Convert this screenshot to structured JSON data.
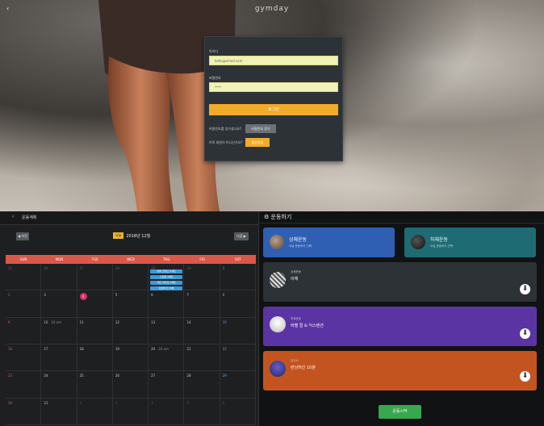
{
  "login_screen": {
    "logo_text": "gymday",
    "back_glyph": "‹",
    "id_label": "아이디",
    "id_value": "hello@email.com",
    "pw_label": "비밀번호",
    "pw_value": "****",
    "login_button": "로그인",
    "find_question": "비밀번호를 잊으셨나요?",
    "find_button": "비밀번호 찾기",
    "signup_question": "아직 회원이 아니신가요?",
    "signup_button": "회원가입"
  },
  "calendar": {
    "title": "운동계획",
    "prev_button": "◀ 이전",
    "next_button": "다음 ▶",
    "today_badge": "오늘",
    "month_label": "2018년 12월",
    "weekdays": [
      "SUN",
      "MON",
      "TUE",
      "WED",
      "THU",
      "FRI",
      "SAT"
    ],
    "weeks": [
      [
        "25",
        "26",
        "27",
        "28",
        "29",
        "30",
        "1"
      ],
      [
        "2",
        "3",
        "4",
        "5",
        "6",
        "7",
        "8"
      ],
      [
        "9",
        "10",
        "11",
        "12",
        "13",
        "14",
        "15"
      ],
      [
        "16",
        "17",
        "18",
        "19",
        "20",
        "21",
        "22"
      ],
      [
        "23",
        "24",
        "25",
        "26",
        "27",
        "28",
        "29"
      ],
      [
        "30",
        "31",
        "1",
        "2",
        "3",
        "4",
        "5"
      ]
    ],
    "today_number": "4",
    "week_labels": {
      "10": "10 am",
      "20": "20 am",
      "30": "30 am"
    },
    "events": [
      "벤치 프레스 5세트",
      "스쿼트 3세트",
      "데드 리프트 4세트",
      "런닝머신 30분"
    ]
  },
  "exercise_panel": {
    "title": "운동하기",
    "upper_card": {
      "name": "상체운동",
      "sub": "오늘 운동하기 선택"
    },
    "lower_card": {
      "name": "하체운동",
      "sub": "오늘 운동하기 선택"
    },
    "list": [
      {
        "category": "상체운동",
        "name": "이체"
      },
      {
        "category": "하체운동",
        "name": "바벨 컬 & 익스텐션"
      },
      {
        "category": "유산소",
        "name": "런닝머신 10분"
      }
    ],
    "start_button": "운동시작"
  },
  "colors": {
    "accent_orange": "#f0ab2a",
    "calendar_header": "#d9584a",
    "today_pink": "#d6326b",
    "event_blue": "#3d9ad8",
    "card_blue": "#2f5fb3",
    "card_teal": "#1e6b74",
    "card_gray": "#2d3237",
    "card_purple": "#5b34a3",
    "card_orange": "#c3541f",
    "start_green": "#37a84e"
  }
}
